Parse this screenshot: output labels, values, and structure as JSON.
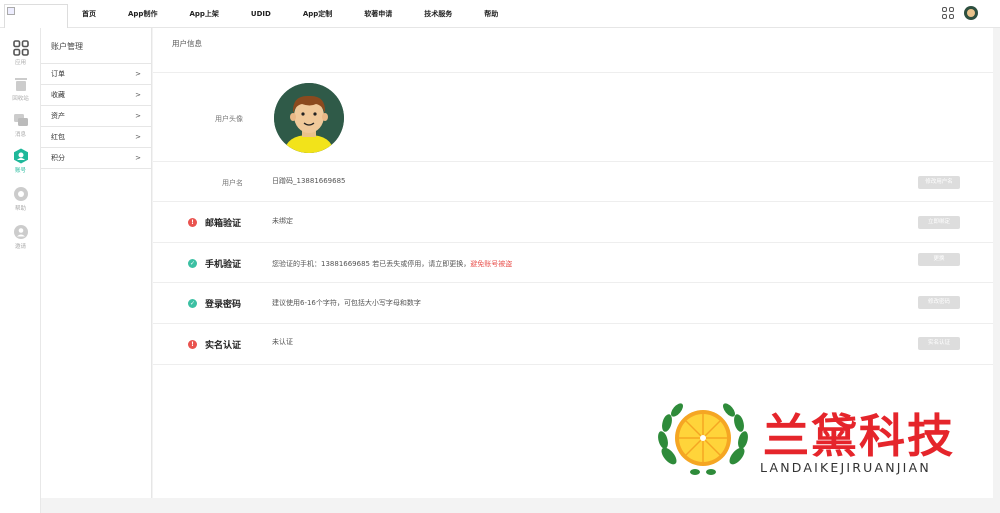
{
  "nav": {
    "items": [
      "首页",
      "App制作",
      "App上架",
      "UDID",
      "App定制",
      "软著申请",
      "技术服务",
      "帮助"
    ]
  },
  "rail": {
    "items": [
      {
        "label": "应用",
        "icon": "apps-icon"
      },
      {
        "label": "回收站",
        "icon": "trash-icon"
      },
      {
        "label": "消息",
        "icon": "message-icon"
      },
      {
        "label": "账号",
        "icon": "account-icon",
        "active": true
      },
      {
        "label": "帮助",
        "icon": "help-icon"
      },
      {
        "label": "邀请",
        "icon": "invite-icon"
      }
    ]
  },
  "submenu": {
    "title": "账户管理",
    "items": [
      {
        "label": "订单",
        "arrow": ">"
      },
      {
        "label": "收藏",
        "arrow": ">"
      },
      {
        "label": "资产",
        "arrow": ">"
      },
      {
        "label": "红包",
        "arrow": ">"
      },
      {
        "label": "积分",
        "arrow": ">"
      }
    ]
  },
  "main": {
    "title": "用户信息",
    "avatar_label": "用户头像",
    "username_label": "用户名",
    "username_value": "日蹭码_13881669685",
    "username_button": "修改用户名",
    "email": {
      "label": "邮箱验证",
      "value": "未绑定",
      "button": "立即绑定",
      "status": "warn"
    },
    "phone": {
      "label": "手机验证",
      "value": "您验证的手机：13881669685 若已丢失或停用，请立即更换，",
      "value_red": "避免账号被盗",
      "button": "更换",
      "status": "ok"
    },
    "password": {
      "label": "登录密码",
      "value": "建议使用6-16个字符，可包括大小写字母和数字",
      "button": "修改密码",
      "status": "ok"
    },
    "realname": {
      "label": "实名认证",
      "value": "未认证",
      "button": "实名认证",
      "status": "warn"
    }
  },
  "watermark": {
    "cn": "兰黛科技",
    "en": "LANDAIKEJIRUANJIAN"
  },
  "colors": {
    "accent": "#1fb89a",
    "warn": "#e9534f",
    "ok": "#3cc0a3",
    "brand_red": "#e5252b"
  }
}
